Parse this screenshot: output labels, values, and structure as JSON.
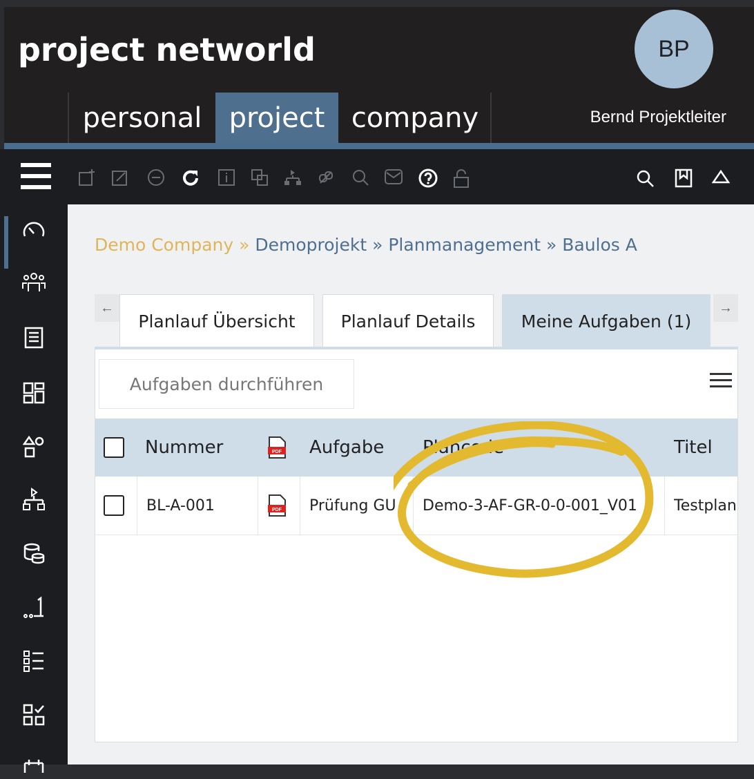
{
  "app": {
    "logo": "project networld",
    "avatar_initials": "BP",
    "username": "Bernd Projektleiter"
  },
  "main_tabs": [
    {
      "label": "personal"
    },
    {
      "label": "project"
    },
    {
      "label": "company"
    }
  ],
  "breadcrumb": {
    "company": "Demo Company",
    "sep": " » ",
    "project": "Demoprojekt",
    "module": "Planmanagement",
    "item": "Baulos A"
  },
  "page_tabs": [
    {
      "label": "Planlauf Übersicht"
    },
    {
      "label": "Planlauf Details"
    },
    {
      "label": "Meine Aufgaben (1)"
    }
  ],
  "actions": {
    "perform_tasks": "Aufgaben durchführen"
  },
  "table": {
    "headers": {
      "nummer": "Nummer",
      "aufgabe": "Aufgabe",
      "plancode": "Plancode",
      "titel": "Titel"
    },
    "rows": [
      {
        "nummer": "BL-A-001",
        "aufgabe": "Prüfung GU",
        "plancode": "Demo-3-AF-GR-0-0-001_V01",
        "titel": "Testplan"
      }
    ]
  },
  "colors": {
    "accent": "#4f6f8f",
    "highlight": "#e3b92f",
    "breadcrumb_company": "#e0b55a"
  }
}
